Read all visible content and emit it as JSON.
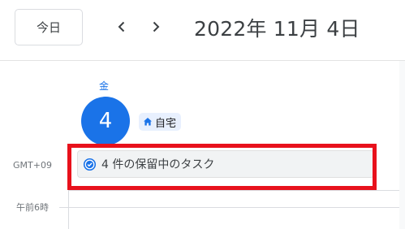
{
  "toolbar": {
    "today_label": "今日",
    "prev_icon": "chevron-left-icon",
    "next_icon": "chevron-right-icon",
    "date_title": "2022年 11月 4日"
  },
  "day": {
    "weekday": "金",
    "date_number": "4",
    "location_icon": "home-icon",
    "location_label": "自宅"
  },
  "timezone_label": "GMT+09",
  "allday": {
    "task_icon": "task-check-icon",
    "task_label": "4 件の保留中のタスク"
  },
  "time_labels": [
    "午前6時"
  ],
  "colors": {
    "accent": "#1a73e8",
    "highlight": "#e8111c",
    "chip_bg": "#e8f0fe",
    "task_bg": "#f1f3f4"
  }
}
